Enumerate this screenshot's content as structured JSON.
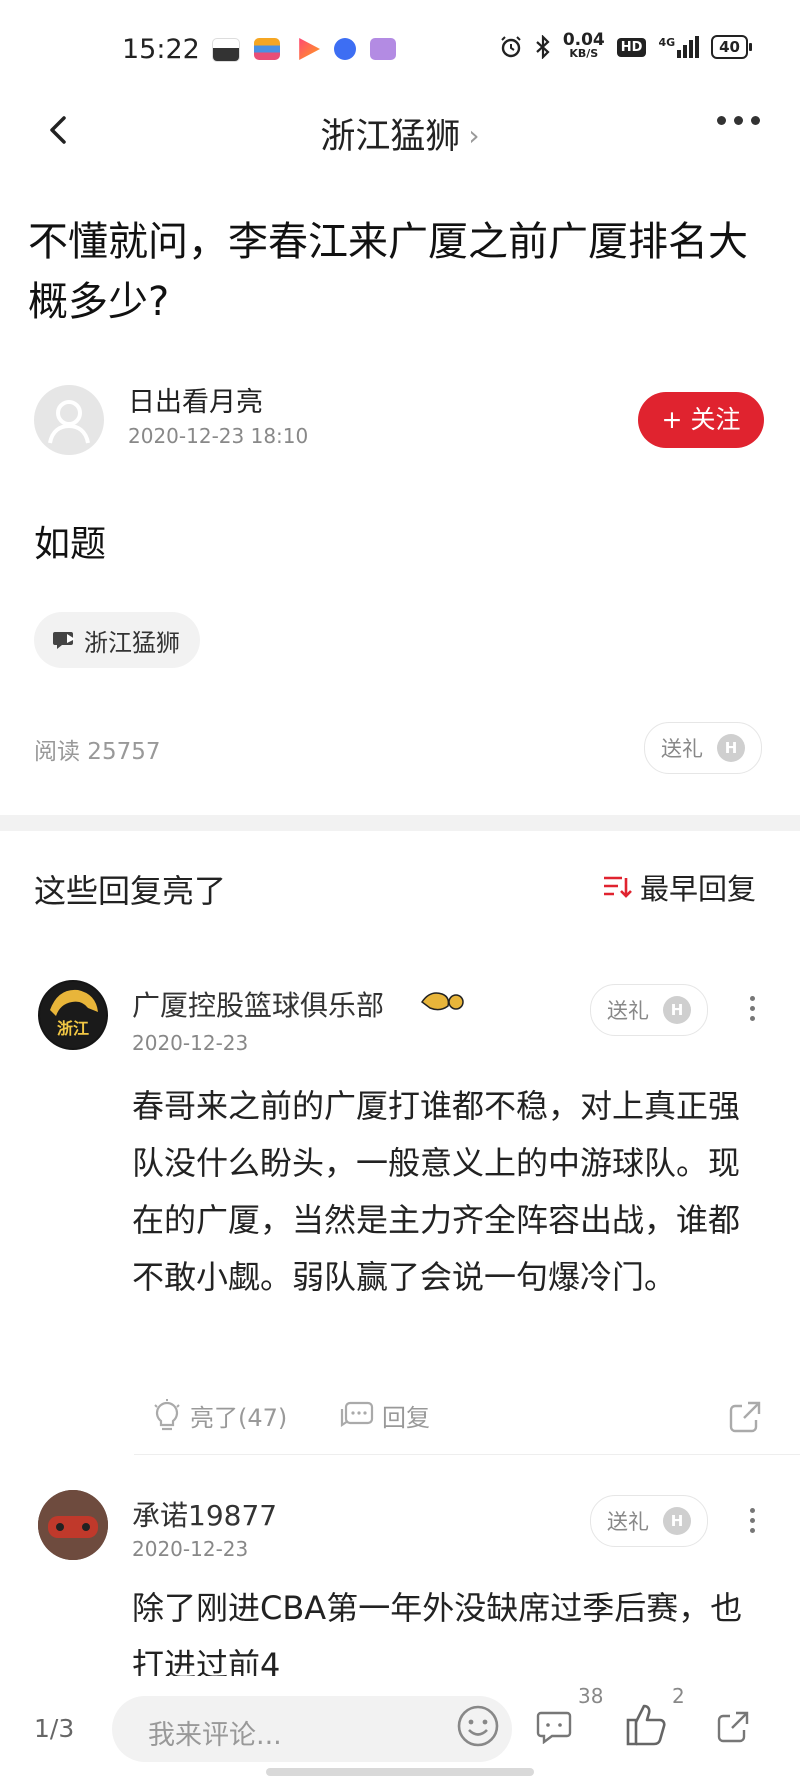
{
  "status_bar": {
    "time": "15:22",
    "net_speed_value": "0.04",
    "net_speed_unit": "KB/S",
    "hd": "HD",
    "network": "4G",
    "battery": "40"
  },
  "header": {
    "title": "浙江猛狮",
    "chevron": "›"
  },
  "post": {
    "title": "不懂就问，李春江来广厦之前广厦排名大概多少?",
    "author": "日出看月亮",
    "time": "2020-12-23 18:10",
    "follow_label": "+ 关注",
    "body": "如题",
    "tag": "浙江猛狮",
    "read_count": "阅读 25757",
    "gift_label": "送礼",
    "gift_badge": "H"
  },
  "comments_section": {
    "title": "这些回复亮了",
    "sort_label": "最早回复"
  },
  "comments": [
    {
      "name": "广厦控股篮球俱乐部",
      "time": "2020-12-23",
      "gift_label": "送礼",
      "gift_badge": "H",
      "text": "春哥来之前的广厦打谁都不稳，对上真正强队没什么盼头，一般意义上的中游球队。现在的广厦，当然是主力齐全阵容出战，谁都不敢小觑。弱队赢了会说一句爆冷门。",
      "like_label": "亮了(47)",
      "reply_label": "回复",
      "avatar_text": "浙江"
    },
    {
      "name": "承诺19877",
      "time": "2020-12-23",
      "gift_label": "送礼",
      "gift_badge": "H",
      "text": "除了刚进CBA第一年外没缺席过季后赛，也打进过前4"
    }
  ],
  "bottom_bar": {
    "page_indicator": "1/3",
    "comment_placeholder": "我来评论...",
    "comment_count": "38",
    "like_count": "2"
  },
  "colors": {
    "accent_red": "#e0232f",
    "divider_gray": "#f2f2f2"
  }
}
